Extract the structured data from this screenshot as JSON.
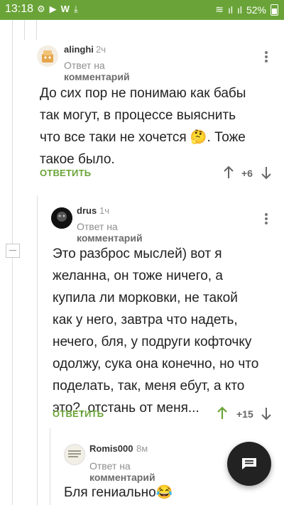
{
  "status_bar": {
    "time": "13:18",
    "battery": "52%"
  },
  "comments": [
    {
      "author": "alinghi",
      "time": "2ч",
      "meta_prefix": "Ответ на",
      "meta_link": "комментарий",
      "text_lines": [
        "До сих пор не понимаю как бабы",
        "так могут, в процессе выяснить",
        "что все таки не хочется 🤔. Тоже",
        "такое было."
      ],
      "reply_label": "ОТВЕТИТЬ",
      "score": "+6"
    },
    {
      "author": "drus",
      "time": "1ч",
      "meta_prefix": "Ответ на",
      "meta_link": "комментарий",
      "text_lines": [
        "Это разброс мыслей) вот я",
        "желанна, он тоже ничего, а",
        "купила ли морковки, не такой",
        "как у него, завтра что надеть,",
        "нечего, бля, у подруги кофточку",
        "одолжу, сука она конечно, но что",
        "поделать, так, меня ебут, а кто",
        "это?, отстань от меня..."
      ],
      "reply_label": "ОТВЕТИТЬ",
      "score": "+15"
    },
    {
      "author": "Romis000",
      "time": "8м",
      "meta_prefix": "Ответ на",
      "meta_link": "комментарий",
      "text_lines": [
        "Бля гениально😂"
      ]
    }
  ],
  "colors": {
    "accent": "#6aa438",
    "fab": "#222222"
  },
  "icons": {
    "fab": "comment-icon",
    "vote_up": "arrow-up-icon",
    "vote_down": "arrow-down-icon"
  }
}
